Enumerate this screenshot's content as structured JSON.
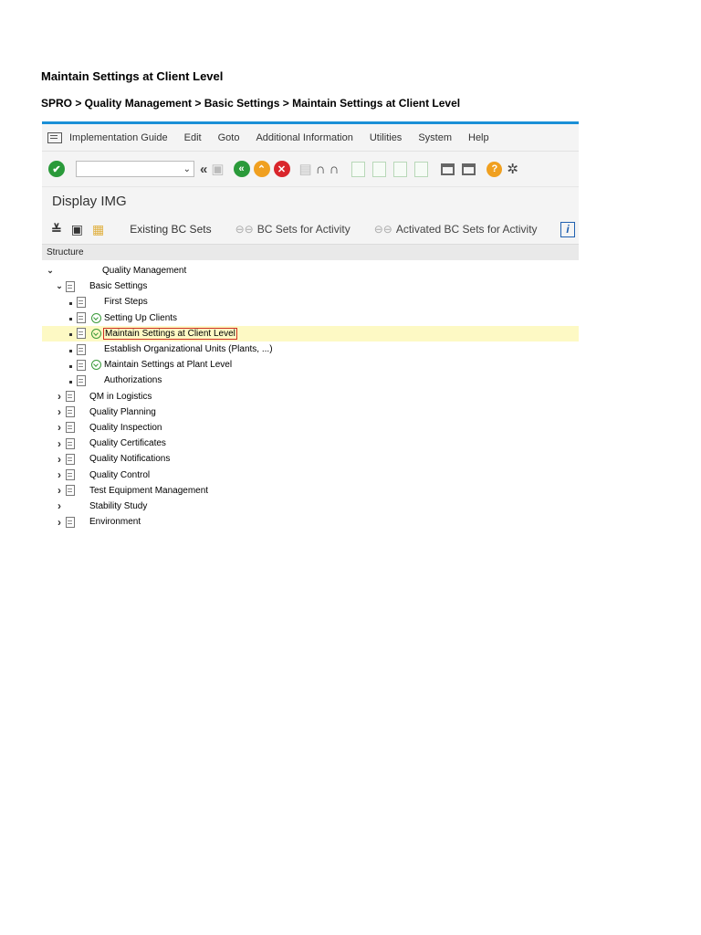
{
  "doc": {
    "title": "Maintain Settings at Client Level",
    "path": "SPRO > Quality Management > Basic Settings > Maintain Settings at Client Level"
  },
  "menu": {
    "items": [
      "Implementation Guide",
      "Edit",
      "Goto",
      "Additional Information",
      "Utilities",
      "System",
      "Help"
    ]
  },
  "toolbar": {
    "command_field_value": "",
    "icons": [
      "enter-icon",
      "back-double-icon",
      "save-icon",
      "back-icon",
      "exit-icon",
      "cancel-icon",
      "print-icon",
      "find-icon",
      "find-next-icon",
      "first-page-icon",
      "previous-page-icon",
      "next-page-icon",
      "last-page-icon",
      "create-session-icon",
      "shortcut-icon",
      "help-icon",
      "customize-layout-icon"
    ]
  },
  "header": {
    "title": "Display IMG"
  },
  "app_toolbar": {
    "existing_bc_sets": "Existing BC Sets",
    "bc_sets_for_activity": "BC Sets for Activity",
    "activated_bc_sets": "Activated BC Sets for Activity"
  },
  "structure": {
    "heading": "Structure",
    "nodes": [
      {
        "label": "Quality Management",
        "level": 0,
        "expander": "open",
        "doc": false,
        "exec": false
      },
      {
        "label": "Basic Settings",
        "level": 1,
        "expander": "open",
        "doc": true,
        "exec": false
      },
      {
        "label": "First Steps",
        "level": 2,
        "expander": "leaf",
        "doc": true,
        "exec": false
      },
      {
        "label": "Setting Up Clients",
        "level": 2,
        "expander": "leaf",
        "doc": true,
        "exec": true
      },
      {
        "label": "Maintain Settings at Client Level",
        "level": 2,
        "expander": "leaf",
        "doc": true,
        "exec": true,
        "selected": true
      },
      {
        "label": "Establish Organizational Units (Plants, ...)",
        "level": 2,
        "expander": "leaf",
        "doc": true,
        "exec": false
      },
      {
        "label": "Maintain Settings at Plant Level",
        "level": 2,
        "expander": "leaf",
        "doc": true,
        "exec": true
      },
      {
        "label": "Authorizations",
        "level": 2,
        "expander": "leaf",
        "doc": true,
        "exec": false
      },
      {
        "label": "QM in Logistics",
        "level": 1,
        "expander": "closed",
        "doc": true,
        "exec": false
      },
      {
        "label": "Quality Planning",
        "level": 1,
        "expander": "closed",
        "doc": true,
        "exec": false
      },
      {
        "label": "Quality Inspection",
        "level": 1,
        "expander": "closed",
        "doc": true,
        "exec": false
      },
      {
        "label": "Quality Certificates",
        "level": 1,
        "expander": "closed",
        "doc": true,
        "exec": false
      },
      {
        "label": "Quality Notifications",
        "level": 1,
        "expander": "closed",
        "doc": true,
        "exec": false
      },
      {
        "label": "Quality Control",
        "level": 1,
        "expander": "closed",
        "doc": true,
        "exec": false
      },
      {
        "label": "Test Equipment Management",
        "level": 1,
        "expander": "closed",
        "doc": true,
        "exec": false
      },
      {
        "label": "Stability Study",
        "level": 1,
        "expander": "closed",
        "doc": false,
        "exec": false
      },
      {
        "label": "Environment",
        "level": 1,
        "expander": "closed",
        "doc": true,
        "exec": false
      }
    ]
  }
}
